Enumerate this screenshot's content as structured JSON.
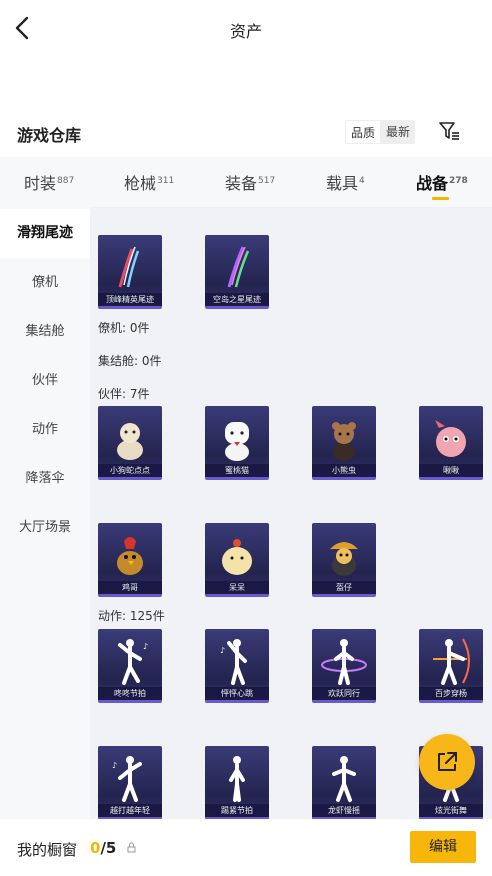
{
  "header": {
    "title": "资产"
  },
  "warehouse": {
    "title": "游戏仓库",
    "sort_quality": "品质",
    "sort_latest": "最新"
  },
  "tabs": [
    {
      "label": "时装",
      "count": "887"
    },
    {
      "label": "枪械",
      "count": "311"
    },
    {
      "label": "装备",
      "count": "517"
    },
    {
      "label": "载具",
      "count": "4"
    },
    {
      "label": "战备",
      "count": "278"
    }
  ],
  "sidebar": {
    "items": [
      {
        "label": "滑翔尾迹"
      },
      {
        "label": "僚机"
      },
      {
        "label": "集结舱"
      },
      {
        "label": "伙伴"
      },
      {
        "label": "动作"
      },
      {
        "label": "降落伞"
      },
      {
        "label": "大厅场景"
      }
    ]
  },
  "sections": {
    "trails": [
      "顶峰精英尾迹",
      "空岛之星尾迹"
    ],
    "wingman": "僚机: 0件",
    "pod": "集结舱: 0件",
    "partner": "伙伴: 7件",
    "partners": [
      "小狗蛇点点",
      "蜜桃猫",
      "小熊虫",
      "啾啾",
      "鸡哥",
      "呆呆",
      "盔仔"
    ],
    "emote": "动作: 125件",
    "emotes": [
      "咚咚节拍",
      "怦怦心跳",
      "欢跃同行",
      "百步穿杨",
      "越打越年轻",
      "踢紧节拍",
      "龙虾慢摇",
      "炫光街舞"
    ]
  },
  "bottom": {
    "label": "我的橱窗",
    "count_now": "0",
    "count_sep": "/",
    "count_max": "5",
    "edit": "编辑"
  },
  "colors": {
    "accent": "#f4b400",
    "card_bg": "#2a2a5e",
    "card_border": "#6a5acd"
  }
}
